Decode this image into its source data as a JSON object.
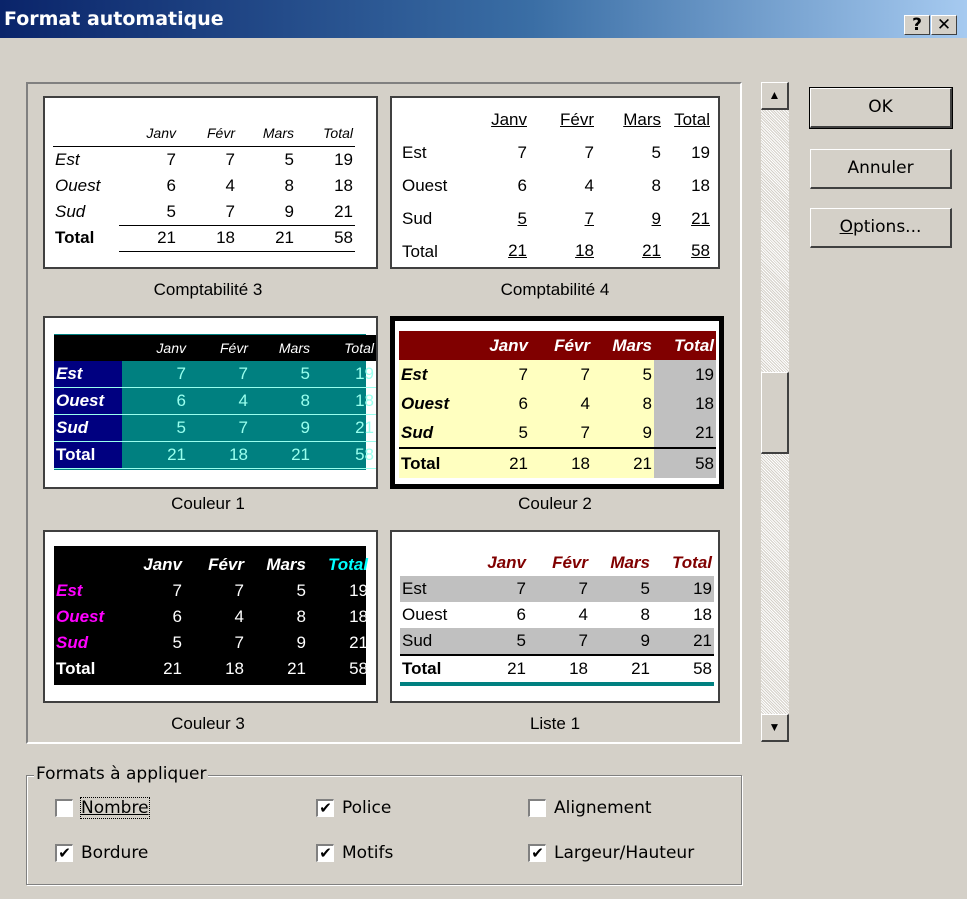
{
  "window": {
    "title": "Format automatique",
    "help_glyph": "?",
    "close_glyph": "✕"
  },
  "months": [
    "Janv",
    "Févr",
    "Mars",
    "Total"
  ],
  "rows": [
    {
      "name": "Est",
      "values": [
        "7",
        "7",
        "5",
        "19"
      ]
    },
    {
      "name": "Ouest",
      "values": [
        "6",
        "4",
        "8",
        "18"
      ]
    },
    {
      "name": "Sud",
      "values": [
        "5",
        "7",
        "9",
        "21"
      ]
    },
    {
      "name": "Total",
      "values": [
        "21",
        "18",
        "21",
        "58"
      ]
    }
  ],
  "formats": [
    {
      "caption": "Comptabilité 3",
      "selected": false
    },
    {
      "caption": "Comptabilité 4",
      "selected": false
    },
    {
      "caption": "Couleur 1",
      "selected": false
    },
    {
      "caption": "Couleur 2",
      "selected": true
    },
    {
      "caption": "Couleur 3",
      "selected": false
    },
    {
      "caption": "Liste 1",
      "selected": false
    }
  ],
  "buttons": {
    "ok": "OK",
    "cancel": "Annuler",
    "options_prefix": "O",
    "options_rest": "ptions..."
  },
  "group": {
    "label": "Formats à appliquer",
    "options": [
      {
        "label": "Nombre",
        "checked": false
      },
      {
        "label": "Police",
        "checked": true
      },
      {
        "label": "Alignement",
        "checked": false
      },
      {
        "label": "Bordure",
        "checked": true
      },
      {
        "label": "Motifs",
        "checked": true
      },
      {
        "label": "Largeur/Hauteur",
        "checked": true
      }
    ]
  },
  "scrollbar": {
    "up_arrow": "▲",
    "down_arrow": "▼"
  }
}
